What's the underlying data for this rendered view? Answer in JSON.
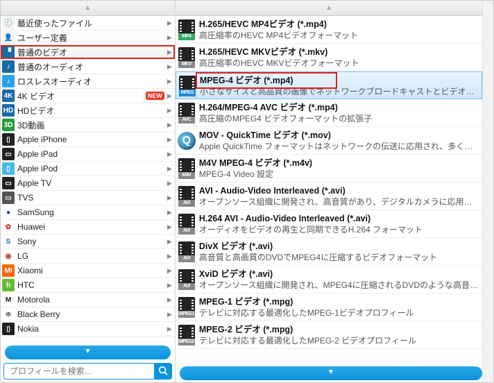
{
  "search": {
    "placeholder": "プロフィールを検索..."
  },
  "categories": [
    {
      "label": "最近使ったファイル",
      "icon_bg": "#f4f4f4",
      "icon_fg": "#888",
      "glyph": "🕘"
    },
    {
      "label": "ユーザー定義",
      "icon_bg": "#f4f4f4",
      "icon_fg": "#888",
      "glyph": "👤"
    },
    {
      "label": "普通のビデオ",
      "icon_bg": "#1a6aa6",
      "icon_fg": "#fff",
      "glyph": "▝",
      "selected": true,
      "highlight": true
    },
    {
      "label": "普通のオーディオ",
      "icon_bg": "#1a6aa6",
      "icon_fg": "#fff",
      "glyph": "♪"
    },
    {
      "label": "ロスレスオーディオ",
      "icon_bg": "#29a3e8",
      "icon_fg": "#fff",
      "glyph": "♪"
    },
    {
      "label": "4K ビデオ",
      "icon_bg": "#1a6aa6",
      "icon_fg": "#fff",
      "glyph": "4K",
      "new": true
    },
    {
      "label": "HDビデオ",
      "icon_bg": "#1a6aa6",
      "icon_fg": "#fff",
      "glyph": "HD"
    },
    {
      "label": "3D動画",
      "icon_bg": "#2a9a3a",
      "icon_fg": "#fff",
      "glyph": "3D"
    },
    {
      "label": "Apple iPhone",
      "icon_bg": "#222",
      "icon_fg": "#fff",
      "glyph": "▯"
    },
    {
      "label": "Apple iPad",
      "icon_bg": "#222",
      "icon_fg": "#fff",
      "glyph": "▭"
    },
    {
      "label": "Apple iPod",
      "icon_bg": "#4ab8e8",
      "icon_fg": "#fff",
      "glyph": "▯"
    },
    {
      "label": "Apple TV",
      "icon_bg": "#222",
      "icon_fg": "#fff",
      "glyph": "▭"
    },
    {
      "label": "TVS",
      "icon_bg": "#555",
      "icon_fg": "#fff",
      "glyph": "▭"
    },
    {
      "label": "SamSung",
      "icon_bg": "#fff",
      "icon_fg": "#1a3a9a",
      "glyph": "●"
    },
    {
      "label": "Huawei",
      "icon_bg": "#fff",
      "icon_fg": "#d22",
      "glyph": "✿"
    },
    {
      "label": "Sony",
      "icon_bg": "#fff",
      "icon_fg": "#1a6aa6",
      "glyph": "S"
    },
    {
      "label": "LG",
      "icon_bg": "#fff",
      "icon_fg": "#b43",
      "glyph": "◉"
    },
    {
      "label": "Xiaomi",
      "icon_bg": "#f60",
      "icon_fg": "#fff",
      "glyph": "MI"
    },
    {
      "label": "HTC",
      "icon_bg": "#6b3",
      "icon_fg": "#fff",
      "glyph": "h"
    },
    {
      "label": "Motorola",
      "icon_bg": "#fff",
      "icon_fg": "#222",
      "glyph": "M"
    },
    {
      "label": "Black Berry",
      "icon_bg": "#fff",
      "icon_fg": "#222",
      "glyph": "፨"
    },
    {
      "label": "Nokia",
      "icon_bg": "#222",
      "icon_fg": "#fff",
      "glyph": "▯"
    }
  ],
  "formats": [
    {
      "tag": "MP4",
      "tag_bg": "#3a6",
      "title": "H.265/HEVC MP4ビデオ (*.mp4)",
      "desc": "高圧縮率のHEVC MP4ビデオフォーマット"
    },
    {
      "tag": "MKV",
      "tag_bg": "#888",
      "title": "H.265/HEVC MKVビデオ (*.mkv)",
      "desc": "高圧縮率のHEVC MKVビデオフォーマット"
    },
    {
      "tag": "MPEG",
      "tag_bg": "#28d",
      "title": "MPEG-4 ビデオ (*.mp4)",
      "desc": "小さなサイズと高品質の画像でネットワークブロードキャストとビデオ…",
      "selected": true,
      "highlight": true
    },
    {
      "tag": "AVC",
      "tag_bg": "#888",
      "title": "H.264/MPEG-4 AVC ビデオ (*.mp4)",
      "desc": "高圧縮のMPEG4 ビデオフォーマットの拡張子"
    },
    {
      "tag": "QT",
      "tag_bg": "",
      "title": "MOV - QuickTime ビデオ (*.mov)",
      "desc": "Apple QuickTime フォーマットはネットワークの伝送に応用され、多く…",
      "qt": true
    },
    {
      "tag": "M4V",
      "tag_bg": "#888",
      "title": "M4V MPEG-4 ビデオ (*.m4v)",
      "desc": "MPEG-4 Video 設定"
    },
    {
      "tag": "AVI",
      "tag_bg": "#888",
      "title": "AVI - Audio-Video Interleaved (*.avi)",
      "desc": "オープンソース組織に開発され、高音質があり、デジタルカメラに応用…"
    },
    {
      "tag": "AVI",
      "tag_bg": "#888",
      "title": "H.264 AVI - Audio-Video Interleaved (*.avi)",
      "desc": "オーディオをビデオの再生と同期できるH.264 フォーマット"
    },
    {
      "tag": "AVI",
      "tag_bg": "#888",
      "title": "DivX ビデオ (*.avi)",
      "desc": "高音質と高画質のDVDでMPEG4に圧縮するビデオフォーマット"
    },
    {
      "tag": "AVI",
      "tag_bg": "#888",
      "title": "XviD ビデオ (*.avi)",
      "desc": "オープンソース組織に開発され、MPEG4に圧縮されるDVDのような高音…"
    },
    {
      "tag": "MPEG1",
      "tag_bg": "#888",
      "title": "MPEG-1 ビデオ (*.mpg)",
      "desc": "テレビに対応する最適化したMPEG-1ビデオプロフィール"
    },
    {
      "tag": "MPEG2",
      "tag_bg": "#888",
      "title": "MPEG-2 ビデオ (*.mpg)",
      "desc": "テレビに対応する最適化したMPEG-2 ビデオプロフィール"
    }
  ]
}
